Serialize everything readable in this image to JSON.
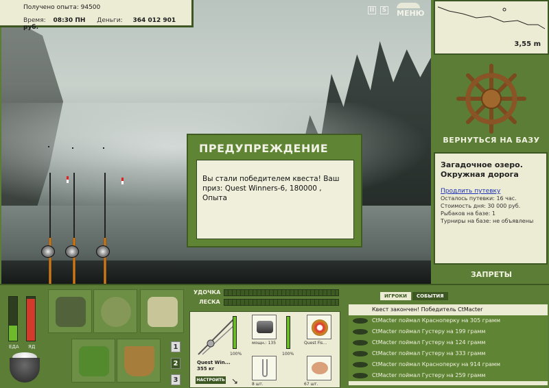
{
  "info": {
    "exp_label": "Получено опыта:",
    "exp_value": "94500",
    "time_label": "Время:",
    "time_value": "08:30 ПН",
    "money_label": "Деньги:",
    "money_value": "364 012 901 руб."
  },
  "top_controls": {
    "pause_label": "II",
    "sound_label": "S",
    "menu_label": "МЕНЮ"
  },
  "depth": {
    "value": "3,55 m"
  },
  "navigation": {
    "return_label": "ВЕРНУТЬСЯ НА БАЗУ",
    "bans_label": "ЗАПРЕТЫ"
  },
  "location": {
    "name_line1": "Загадочное озеро.",
    "name_line2": "Окружная дорога",
    "extend_link": "Продлить путевку",
    "remaining": "Осталось путевки: 16 час.",
    "day_cost": "Стоимость дня: 30 000 руб.",
    "fishers": "Рыбаков на базе: 1",
    "tournaments": "Турниры на базе: не объявлены"
  },
  "modal": {
    "title": "ПРЕДУПРЕЖДЕНИЕ",
    "text": "Вы стали победителем квеста! Ваш приз: Quest Winners-6, 180000 , Опыта"
  },
  "stats": {
    "food_label": "ЕДА",
    "poison_label": "ЯД",
    "food_level": 0.35,
    "poison_level": 0.95
  },
  "tabs_numbers": [
    "1",
    "2",
    "3"
  ],
  "tackle": {
    "rod_label": "УДОЧКА",
    "line_label": "ЛЕСКА",
    "rod_name": "Quest Win...",
    "rod_weight": "355 кг",
    "setup_label": "НАСТРОИТЬ",
    "rod_pct": "100%",
    "reel_label": "мощн.: 135",
    "reel_pct": "100%",
    "line_name": "Quest Fis...",
    "hooks_count": "8 шт.",
    "bait_count": "67 шт."
  },
  "log": {
    "tab_players": "ИГРОКИ",
    "tab_events": "СОБЫТИЯ",
    "header": "Квест закончен! Победитель CtMacter",
    "rows": [
      "CtMacter поймал Красноперку на 305 грамм",
      "CtMacter поймал Густеру на 199 грамм",
      "CtMacter поймал Густеру на 124 грамм",
      "CtMacter поймал Густеру на 333 грамм",
      "CtMacter поймал Красноперку на 914 грамм",
      "CtMacter поймал Густеру на 259 грамм"
    ]
  }
}
